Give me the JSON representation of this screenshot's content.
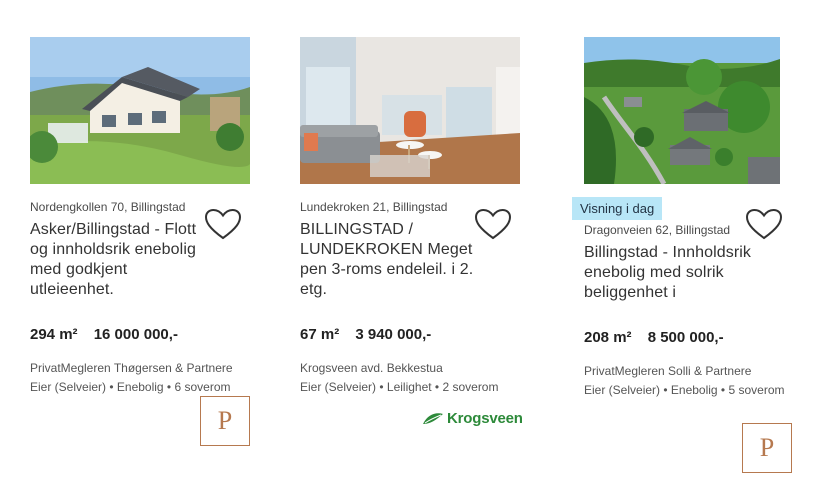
{
  "listings": [
    {
      "address": "Nordengkollen 70, Billingstad",
      "title": "Asker/Billingstad - Flott og innholdsrik enebolig med godkjent utleieenhet.",
      "size": "294 m²",
      "price": "16 000 000,-",
      "broker": "PrivatMegleren Thøgersen & Partnere",
      "details": "Eier (Selveier) • Enebolig • 6 soverom",
      "broker_logo": "P"
    },
    {
      "address": "Lundekroken 21, Billingstad",
      "title": "BILLINGSTAD / LUNDEKROKEN Meget pen 3-roms endeleil. i 2. etg.",
      "size": "67 m²",
      "price": "3 940 000,-",
      "broker": "Krogsveen avd. Bekkestua",
      "details": "Eier (Selveier) • Leilighet • 2 soverom",
      "broker_logo": "Krogsveen"
    },
    {
      "badge": "Visning i dag",
      "address": "Dragonveien 62, Billingstad",
      "title": "Billingstad - Innholdsrik enebolig med solrik beliggenhet i",
      "size": "208 m²",
      "price": "8 500 000,-",
      "broker": "PrivatMegleren Solli & Partnere",
      "details": "Eier (Selveier) • Enebolig • 5 soverom",
      "broker_logo": "P"
    }
  ],
  "colors": {
    "badge_bg": "#b8e6f7",
    "privatmegleren": "#b6794f",
    "krogsveen": "#2d8a3a"
  },
  "icons": [
    "heart-icon"
  ]
}
